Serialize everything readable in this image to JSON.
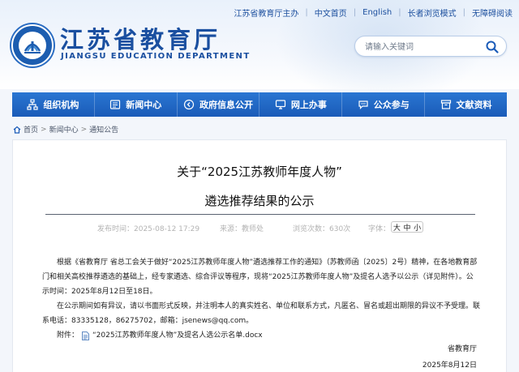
{
  "top_links": [
    "江苏省教育厅主办",
    "中文首页",
    "English",
    "长者浏览模式",
    "无障碍阅读"
  ],
  "site": {
    "title": "江苏省教育厅",
    "subtitle": "JIANGSU EDUCATION DEPARTMENT"
  },
  "search": {
    "placeholder": "请输入关键词",
    "icon": "search-icon"
  },
  "nav": [
    {
      "label": "组织机构",
      "icon": "org-chart-icon"
    },
    {
      "label": "新闻中心",
      "icon": "newspaper-icon"
    },
    {
      "label": "政府信息公开",
      "icon": "info-disclosure-icon"
    },
    {
      "label": "网上办事",
      "icon": "monitor-icon"
    },
    {
      "label": "公众参与",
      "icon": "chat-bubble-icon"
    },
    {
      "label": "文献资料",
      "icon": "archive-icon"
    }
  ],
  "breadcrumb": [
    "首页",
    "新闻中心",
    "通知公告"
  ],
  "article": {
    "title_line1": "关于“2025江苏教师年度人物”",
    "title_line2": "遴选推荐结果的公示",
    "meta": {
      "publish": "发布时间：2025-08-12 17:29",
      "source": "来源：教师处",
      "views": "浏览次数：630次",
      "font_label": "字体：",
      "font_sizes": [
        "大",
        "中",
        "小"
      ]
    },
    "paragraphs": [
      "根据《省教育厅 省总工会关于做好“2025江苏教师年度人物”遴选推荐工作的通知》（苏教师函〔2025〕2号）精神，在各地教育部门和相关高校推荐遴选的基础上，经专家遴选、综合评议等程序，现将“2025江苏教师年度人物”及提名人选予以公示（详见附件）。公示时间：2025年8月12日至18日。",
      "在公示期间如有异议，请以书面形式反映，并注明本人的真实姓名、单位和联系方式，凡匿名、冒名或超出期限的异议不予受理。联系电话：83335128，86275702，邮箱：jsenews@qq.com。"
    ],
    "attachment_label": "附件：",
    "attachment_name": "“2025江苏教师年度人物”及提名人选公示名单.docx",
    "signature": "省教育厅",
    "date": "2025年8月12日"
  },
  "colors": {
    "nav_bg": "#1a5bb8",
    "brand": "#1a4fa0",
    "page_bg": "#f3f6fb"
  }
}
